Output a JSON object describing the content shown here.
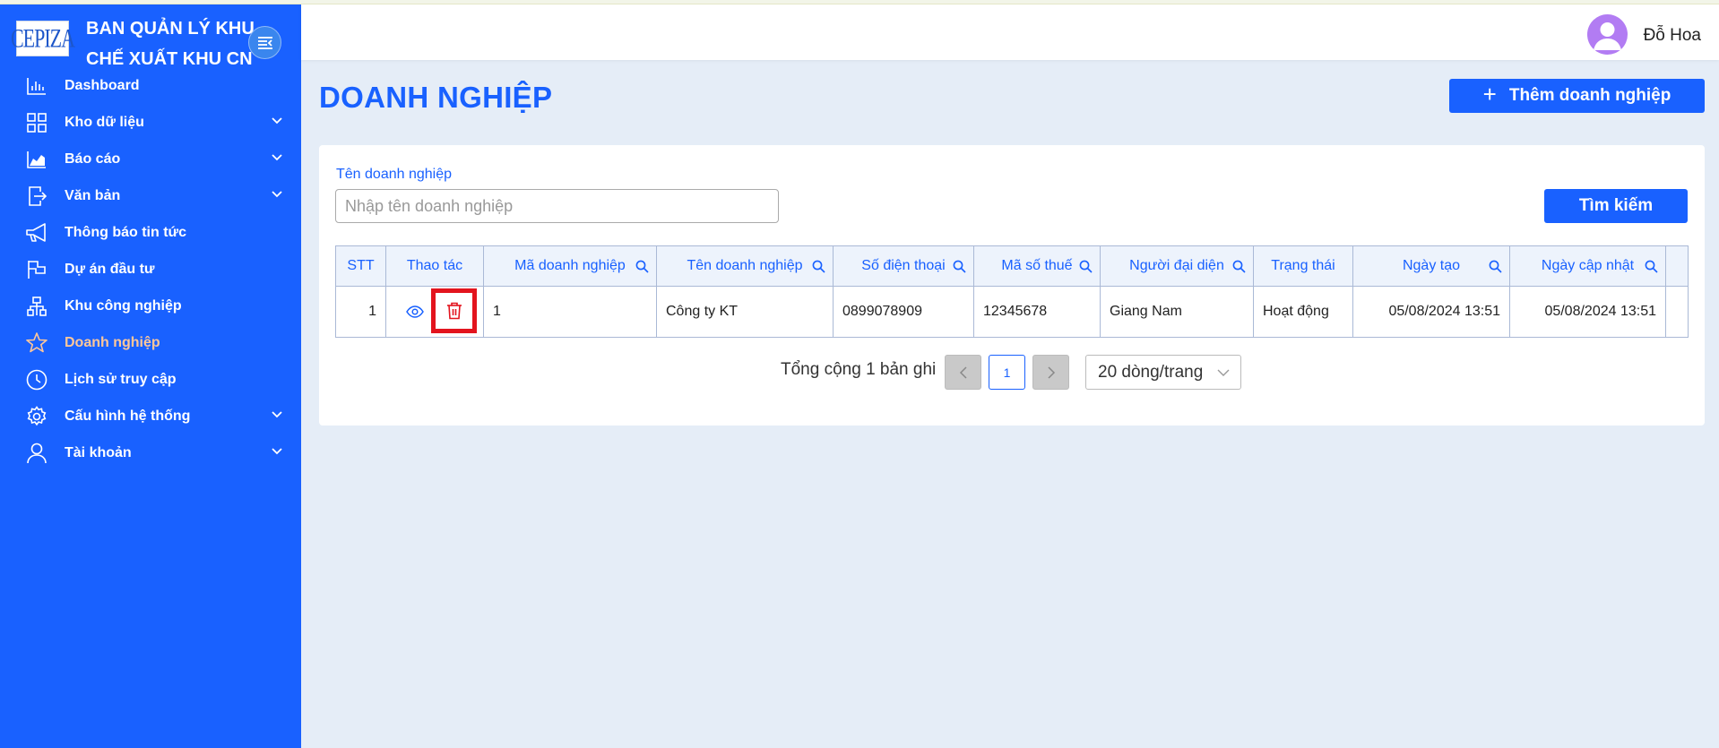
{
  "app": {
    "logo_text": "CEPIZA",
    "brand_line1": "BAN QUẢN LÝ KHU",
    "brand_line2": "CHẾ XUẤT KHU CN"
  },
  "sidebar": {
    "items": [
      {
        "label": "Dashboard",
        "icon": "bar-chart-icon",
        "expandable": false,
        "active": false
      },
      {
        "label": "Kho dữ liệu",
        "icon": "grid-icon",
        "expandable": true,
        "active": false
      },
      {
        "label": "Báo cáo",
        "icon": "area-chart-icon",
        "expandable": true,
        "active": false
      },
      {
        "label": "Văn bản",
        "icon": "document-export-icon",
        "expandable": true,
        "active": false
      },
      {
        "label": "Thông báo tin tức",
        "icon": "megaphone-icon",
        "expandable": false,
        "active": false
      },
      {
        "label": "Dự án đầu tư",
        "icon": "flag-icon",
        "expandable": false,
        "active": false
      },
      {
        "label": "Khu công nghiệp",
        "icon": "cluster-icon",
        "expandable": false,
        "active": false
      },
      {
        "label": "Doanh nghiệp",
        "icon": "star-icon",
        "expandable": false,
        "active": true
      },
      {
        "label": "Lịch sử truy cập",
        "icon": "clock-icon",
        "expandable": false,
        "active": false
      },
      {
        "label": "Cấu hình hệ thống",
        "icon": "gear-icon",
        "expandable": true,
        "active": false
      },
      {
        "label": "Tài khoản",
        "icon": "user-icon",
        "expandable": true,
        "active": false
      }
    ]
  },
  "header": {
    "user_name": "Đỗ Hoa"
  },
  "page": {
    "title": "DOANH NGHIỆP",
    "add_button": "Thêm doanh nghiệp"
  },
  "filter": {
    "label": "Tên doanh nghiệp",
    "placeholder": "Nhập tên doanh nghiệp",
    "value": "",
    "search_button": "Tìm kiếm"
  },
  "table": {
    "columns": [
      {
        "label": "STT",
        "searchable": false
      },
      {
        "label": "Thao tác",
        "searchable": false
      },
      {
        "label": "Mã doanh nghiệp",
        "searchable": true
      },
      {
        "label": "Tên doanh nghiệp",
        "searchable": true
      },
      {
        "label": "Số điện thoại",
        "searchable": true
      },
      {
        "label": "Mã số thuế",
        "searchable": true
      },
      {
        "label": "Người đại diện",
        "searchable": true
      },
      {
        "label": "Trạng thái",
        "searchable": false
      },
      {
        "label": "Ngày tạo",
        "searchable": true
      },
      {
        "label": "Ngày cập nhật",
        "searchable": true
      }
    ],
    "rows": [
      {
        "stt": "1",
        "ma": "1",
        "ten": "Công ty KT",
        "sdt": "0899078909",
        "mst": "12345678",
        "nguoi_dai_dien": "Giang Nam",
        "trang_thai": "Hoạt động",
        "ngay_tao": "05/08/2024 13:51",
        "ngay_cap_nhat": "05/08/2024 13:51"
      }
    ]
  },
  "pagination": {
    "total_text": "Tổng cộng 1 bản ghi",
    "current_page": "1",
    "prev_icon": "chevron-left-icon",
    "next_icon": "chevron-right-icon",
    "page_size": "20 dòng/trang"
  },
  "colors": {
    "primary": "#1961ff",
    "active_menu": "#ffc799",
    "status_active": "#2aa843",
    "highlight": "#e3141e",
    "background": "#e5edf7"
  }
}
